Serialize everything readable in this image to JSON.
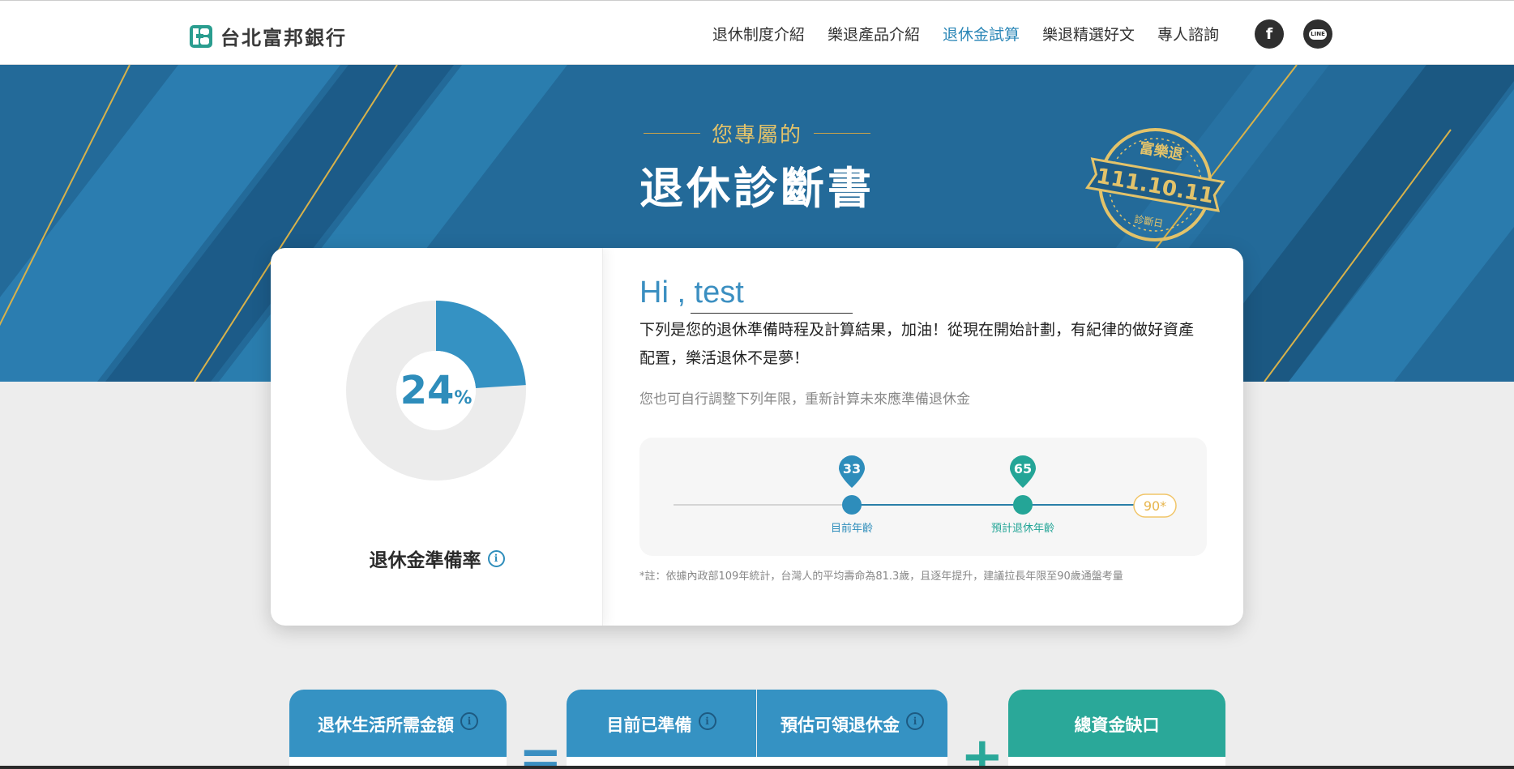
{
  "header": {
    "brand": "台北富邦銀行",
    "nav": [
      {
        "label": "退休制度介紹",
        "active": false
      },
      {
        "label": "樂退產品介紹",
        "active": false
      },
      {
        "label": "退休金試算",
        "active": true
      },
      {
        "label": "樂退精選好文",
        "active": false
      },
      {
        "label": "專人諮詢",
        "active": false
      }
    ],
    "social": {
      "facebook": "f",
      "line": "LINE"
    }
  },
  "hero": {
    "subtitle": "您專屬的",
    "title": "退休診斷書",
    "stamp": {
      "top": "富樂退",
      "date": "111.10.11",
      "bottom": "診斷日"
    }
  },
  "readiness": {
    "percent_value": "24",
    "percent_sign": "%",
    "fraction": 0.24,
    "label": "退休金準備率",
    "info_icon": "i"
  },
  "summary": {
    "greeting": "Hi , test",
    "intro": "下列是您的退休準備時程及計算結果，加油！從現在開始計劃，有紀律的做好資產配置，樂活退休不是夢！",
    "hint": "您也可自行調整下列年限，重新計算未來應準備退休金",
    "timeline": {
      "current_age": "33",
      "current_label": "目前年齡",
      "retire_age": "65",
      "retire_label": "預計退休年齡",
      "end_age": "90*"
    },
    "note": "*註：依據內政部109年統計，台灣人的平均壽命為81.3歲，且逐年提升，建議拉長年限至90歲通盤考量"
  },
  "bottom": {
    "cards": [
      {
        "label": "退休生活所需金額",
        "info": "i"
      },
      {
        "label": "目前已準備",
        "info": "i"
      },
      {
        "label": "預估可領退休金",
        "info": "i"
      },
      {
        "label": "總資金缺口"
      }
    ],
    "eq": "=",
    "plus": "+"
  },
  "colors": {
    "accent_blue": "#3b8fc1",
    "accent_teal": "#2aa899",
    "gold": "#e3c36a",
    "hero_blue": "#1f5d87"
  }
}
